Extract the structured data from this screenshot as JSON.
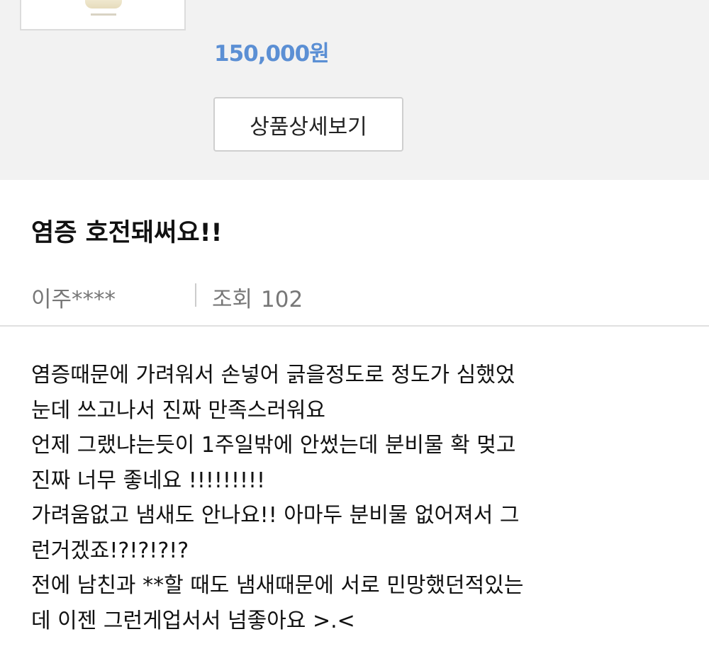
{
  "product": {
    "price": "150,000원",
    "detail_button_label": "상품상세보기"
  },
  "post": {
    "title": "염증 호전돼써요!!",
    "author": "이주****",
    "views_label": "조회",
    "views_count": "102",
    "body_lines": [
      "염증때문에 가려워서 손넣어 긁을정도로 정도가 심했었",
      "눈데 쓰고나서 진짜 만족스러워요",
      "언제 그랬냐는듯이 1주일밖에 안썼는데 분비물 확 멎고",
      "진짜 너무 좋네요 !!!!!!!!!",
      "가려움없고 냄새도 안나요!! 아마두 분비물 없어져서 그",
      "런거겠죠!?!?!?!?",
      "전에 남친과 **할 때도 냄새때문에 서로 민망했던적있는",
      "데 이젠 그런게업서서 넘좋아요 >.<"
    ]
  },
  "colors": {
    "price": "#5b8fd4",
    "panel_background": "#f2f2f2"
  }
}
